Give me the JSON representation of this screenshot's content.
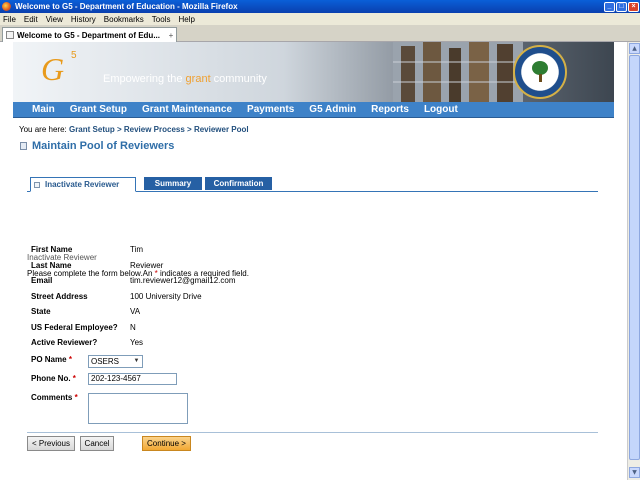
{
  "window": {
    "title": "Welcome to G5 - Department of Education - Mozilla Firefox",
    "controls": [
      "_",
      "□",
      "×"
    ]
  },
  "menubar": [
    "File",
    "Edit",
    "View",
    "History",
    "Bookmarks",
    "Tools",
    "Help"
  ],
  "browser_tab": {
    "title": "Welcome to G5 - Department of Edu...",
    "close": "+"
  },
  "banner": {
    "logo": "G",
    "logo_sup": "5",
    "tagline_pre": "Empowering the ",
    "tagline_accent": "grant",
    "tagline_post": " community"
  },
  "nav": [
    "Main",
    "Grant Setup",
    "Grant Maintenance",
    "Payments",
    "G5 Admin",
    "Reports",
    "Logout"
  ],
  "breadcrumb": {
    "prefix": "You are here: ",
    "items": [
      "Grant Setup",
      "Review Process",
      "Reviewer Pool"
    ],
    "sep": " > "
  },
  "page_title": "Maintain Pool of Reviewers",
  "wizard_tabs": [
    "Inactivate Reviewer",
    "Summary",
    "Confirmation"
  ],
  "section_label": "Inactivate Reviewer",
  "instructions": {
    "pre": "Please complete the form below.An ",
    "star": "*",
    "post": " indicates a required field."
  },
  "fields": [
    {
      "label": "First Name",
      "value": "Tim"
    },
    {
      "label": "Last Name",
      "value": "Reviewer"
    },
    {
      "label": "Email",
      "value": "tim.reviewer12@gmail12.com"
    },
    {
      "label": "Street Address",
      "value": "100 University Drive"
    },
    {
      "label": "State",
      "value": "VA"
    },
    {
      "label": "US Federal Employee?",
      "value": "N"
    },
    {
      "label": "Active Reviewer?",
      "value": "Yes"
    }
  ],
  "po_name": {
    "label": "PO Name",
    "selected": "OSERS"
  },
  "phone": {
    "label": "Phone No.",
    "value": "202-123-4567"
  },
  "comments": {
    "label": "Comments",
    "value": ""
  },
  "buttons": {
    "previous": "< Previous",
    "cancel": "Cancel",
    "continue": "Continue >"
  }
}
